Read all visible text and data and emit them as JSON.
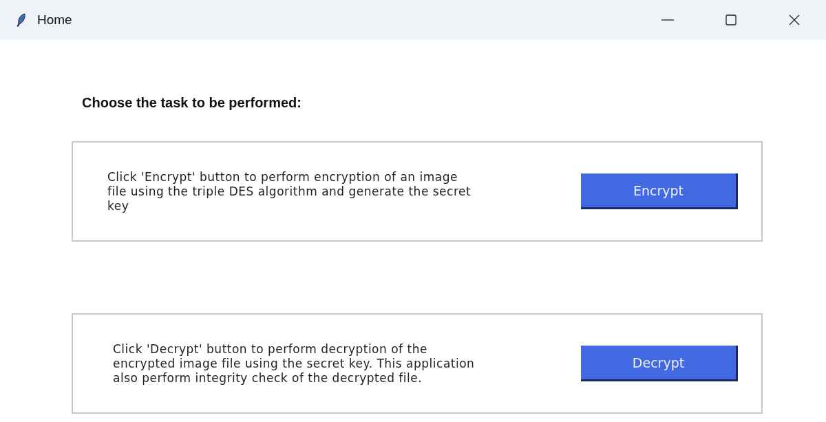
{
  "window": {
    "title": "Home"
  },
  "heading": "Choose the task to be performed:",
  "tasks": [
    {
      "description_lines": [
        "Click 'Encrypt' button to perform encryption of an image",
        "file using the triple DES algorithm and generate the secret",
        "key"
      ],
      "button": "Encrypt"
    },
    {
      "description_lines": [
        "Click 'Decrypt' button to perform decryption of the",
        "encrypted image file using the secret key. This application",
        "also perform integrity check of the decrypted file."
      ],
      "button": "Decrypt"
    }
  ]
}
